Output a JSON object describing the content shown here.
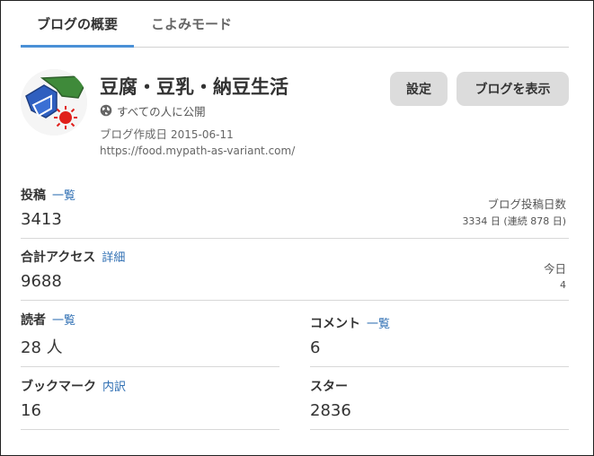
{
  "tabs": [
    {
      "label": "ブログの概要",
      "active": true
    },
    {
      "label": "こよみモード",
      "active": false
    }
  ],
  "blog": {
    "title": "豆腐・豆乳・納豆生活",
    "visibility": "すべての人に公開",
    "created_label": "ブログ作成日",
    "created_date": "2015-06-11",
    "url": "https://food.mypath-as-variant.com/",
    "icon": "tofu-sun-logo-icon"
  },
  "buttons": {
    "settings": "設定",
    "view_blog": "ブログを表示"
  },
  "stats": {
    "posts": {
      "label": "投稿",
      "link": "一覧",
      "value": "3413"
    },
    "post_days": {
      "label": "ブログ投稿日数",
      "value": "3334 日 (連続 878 日)"
    },
    "access": {
      "label": "合計アクセス",
      "link": "詳細",
      "value": "9688"
    },
    "today": {
      "label": "今日",
      "value": "4"
    },
    "readers": {
      "label": "読者",
      "link": "一覧",
      "value": "28 人"
    },
    "comments": {
      "label": "コメント",
      "link": "一覧",
      "value": "6"
    },
    "bookmarks": {
      "label": "ブックマーク",
      "link": "内訳",
      "value": "16"
    },
    "stars": {
      "label": "スター",
      "value": "2836"
    }
  },
  "colors": {
    "link": "#2f6fb3",
    "tab_underline": "#4a90d6",
    "button_bg": "#dcdcdc"
  }
}
